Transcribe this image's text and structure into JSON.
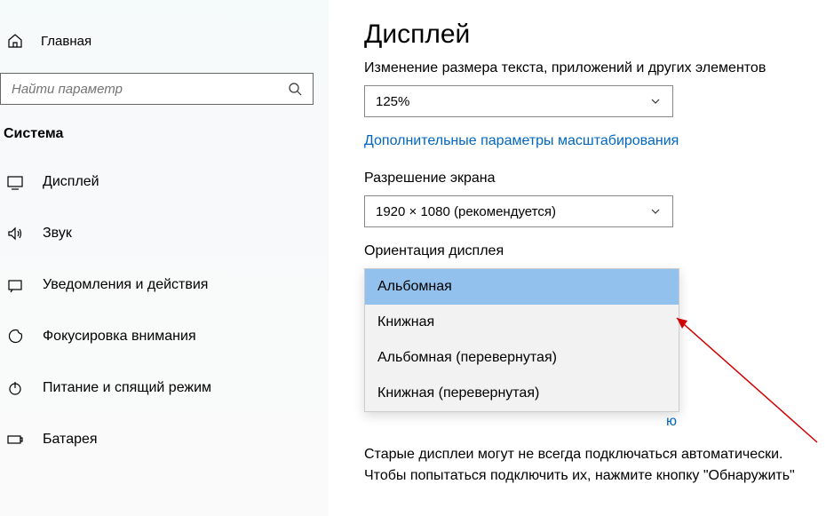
{
  "sidebar": {
    "home_label": "Главная",
    "search_placeholder": "Найти параметр",
    "section_heading": "Система",
    "items": [
      {
        "label": "Дисплей"
      },
      {
        "label": "Звук"
      },
      {
        "label": "Уведомления и действия"
      },
      {
        "label": "Фокусировка внимания"
      },
      {
        "label": "Питание и спящий режим"
      },
      {
        "label": "Батарея"
      }
    ]
  },
  "content": {
    "page_title": "Дисплей",
    "scale_label": "Изменение размера текста, приложений и других элементов",
    "scale_value": "125%",
    "advanced_link": "Дополнительные параметры масштабирования",
    "resolution_label": "Разрешение экрана",
    "resolution_value": "1920 × 1080 (рекомендуется)",
    "orientation_label": "Ориентация дисплея",
    "orientation_options": [
      "Альбомная",
      "Книжная",
      "Альбомная (перевернутая)",
      "Книжная (перевернутая)"
    ],
    "partial_link_tail": "ю",
    "body_text": "Старые дисплеи могут не всегда подключаться автоматически. Чтобы попытаться подключить их, нажмите кнопку \"Обнаружить\""
  }
}
